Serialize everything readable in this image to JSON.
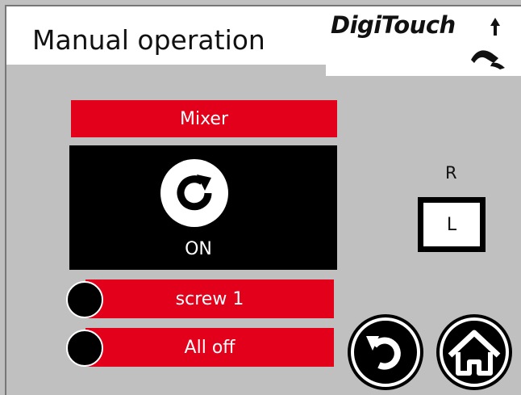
{
  "header": {
    "title": "Manual operation",
    "logo_text": "DigiTouch"
  },
  "mixer": {
    "label": "Mixer",
    "status": "ON",
    "icon": "rotate-clockwise-icon"
  },
  "direction": {
    "r_label": "R",
    "l_button_label": "L"
  },
  "rows": [
    {
      "label": "screw 1",
      "indicator_icon": "status-indicator-icon"
    },
    {
      "label": "All off",
      "indicator_icon": "status-indicator-icon"
    }
  ],
  "nav": {
    "back_icon": "back-arrow-icon",
    "home_icon": "home-icon"
  },
  "colors": {
    "accent_red": "#e3001b",
    "panel_black": "#000000",
    "background_gray": "#c0c0c0"
  }
}
